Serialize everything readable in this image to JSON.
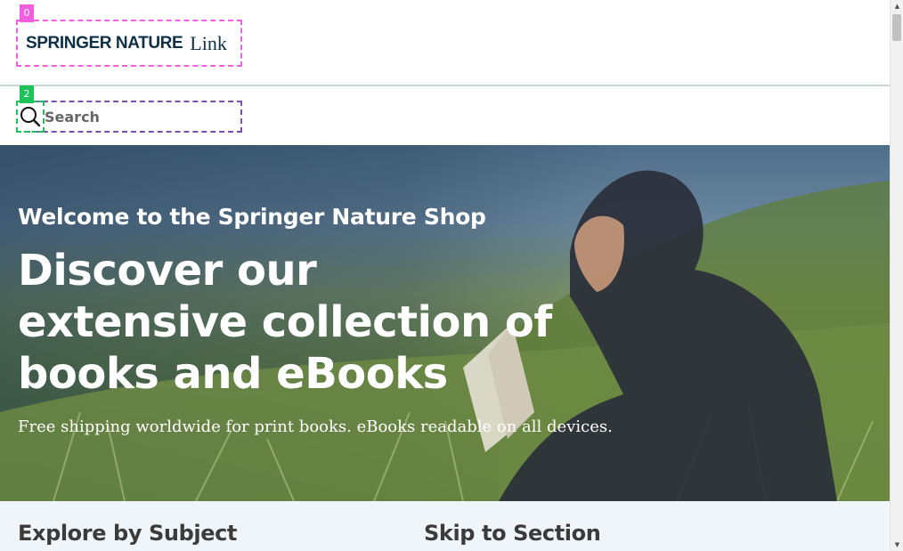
{
  "header": {
    "logo_brand": "SPRINGER NATURE",
    "logo_link": "Link",
    "badge_logo": "0"
  },
  "search": {
    "placeholder": "Search",
    "badge": "2",
    "icon": "search-icon"
  },
  "hero": {
    "welcome": "Welcome to the Springer Nature Shop",
    "title": "Discover our extensive collection of books and eBooks",
    "subtitle": "Free shipping worldwide for print books. eBooks readable on all devices."
  },
  "sections": {
    "explore": "Explore by Subject",
    "skip": "Skip to Section"
  },
  "scrollbar": {
    "up": "▲",
    "down": "▼"
  },
  "colors": {
    "brand": "#0e3047",
    "logo_badge": "#f25ee0",
    "search_badge": "#1ec25a",
    "search_outline": "#7b4fb0",
    "section_bg": "#f0f5fa"
  }
}
